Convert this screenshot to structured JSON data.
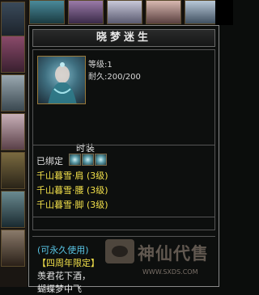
{
  "tooltip": {
    "title": "晓梦迷生",
    "level": "等级:1",
    "durability": "耐久:200/200",
    "section": "时装",
    "bound": "已绑定",
    "set_items": [
      "千山暮雪·肩 (3级)",
      "千山暮雪·腰 (3级)",
      "千山暮雪·脚 (3级)"
    ],
    "permanent": "(可永久使用)",
    "limited": "【四周年限定】",
    "poem_line1": "羡君花下酒，",
    "poem_line2": "蝴蝶梦中飞"
  },
  "watermark": {
    "text": "神仙代售",
    "url": "WWW.SXDS.COM"
  },
  "colors": {
    "set_text": "#f2e04a",
    "permanent_text": "#59c6e6",
    "border": "#8a8a8a"
  },
  "icons": [
    "item-portrait-icon",
    "gem-socket-icon",
    "watermark-logo-icon"
  ]
}
